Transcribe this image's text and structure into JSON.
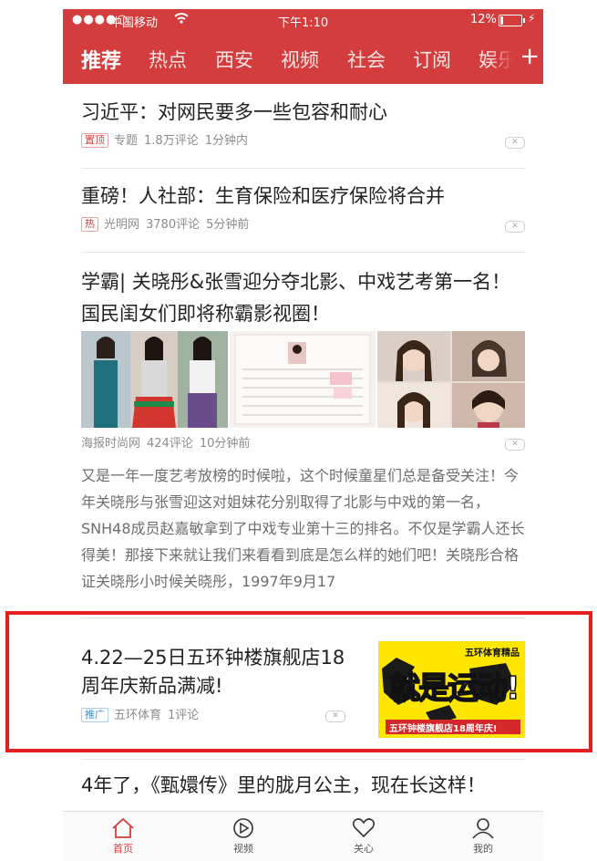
{
  "status_bar": {
    "signal": "●●●●○",
    "carrier": "中国移动",
    "time": "下午1:10",
    "battery": "12%",
    "battery_level": 0.12
  },
  "nav": {
    "tabs": [
      "推荐",
      "热点",
      "西安",
      "视频",
      "社会",
      "订阅",
      "娱乐"
    ],
    "active_tab": "推荐",
    "add_label": "+"
  },
  "feed": [
    {
      "title": "习近平：对网民要多一些包容和耐心",
      "tag": "置顶",
      "source": "专题",
      "comments": "1.8万评论",
      "time": "1分钟内"
    },
    {
      "title": "重磅！人社部：生育保险和医疗保险将合并",
      "tag": "热",
      "source": "光明网",
      "comments": "3780评论",
      "time": "5分钟前"
    },
    {
      "title": "学霸| 关晓彤&张雪迎分夺北影、中戏艺考第一名！国民闺女们即将称霸影视圈！",
      "source": "海报时尚网",
      "comments": "424评论",
      "time": "10分钟前",
      "excerpt": "又是一年一度艺考放榜的时候啦，这个时候童星们总是备受关注！今年关晓彤与张雪迎这对姐妹花分别取得了北影与中戏的第一名，SNH48成员赵嘉敏拿到了中戏专业第十三的排名。不仅是学霸人还长得美！那接下来就让我们来看看到底是怎么样的她们吧！关晓彤合格证关晓彤小时候关晓彤，1997年9月17"
    },
    {
      "title": "4.22—25日五环钟楼旗舰店18周年庆新品满减!",
      "tag": "推广",
      "source": "五环体育",
      "comments": "1评论",
      "ad_image": {
        "brand": "五环体育精品",
        "slogan": "就是运动!",
        "banner": "五环钟楼旗舰店18周年庆!"
      }
    },
    {
      "title": "4年了，《甄嬛传》里的胧月公主，现在长这样！"
    }
  ],
  "tabbar": {
    "items": [
      {
        "label": "首页",
        "icon": "home-icon"
      },
      {
        "label": "视频",
        "icon": "video-play-icon"
      },
      {
        "label": "关心",
        "icon": "heart-icon"
      },
      {
        "label": "我的",
        "icon": "person-icon"
      }
    ],
    "active_index": 0
  },
  "colors": {
    "brand_red": "#d43d3d",
    "highlight_border": "#e81f1f",
    "ad_yellow": "#ffe600"
  }
}
